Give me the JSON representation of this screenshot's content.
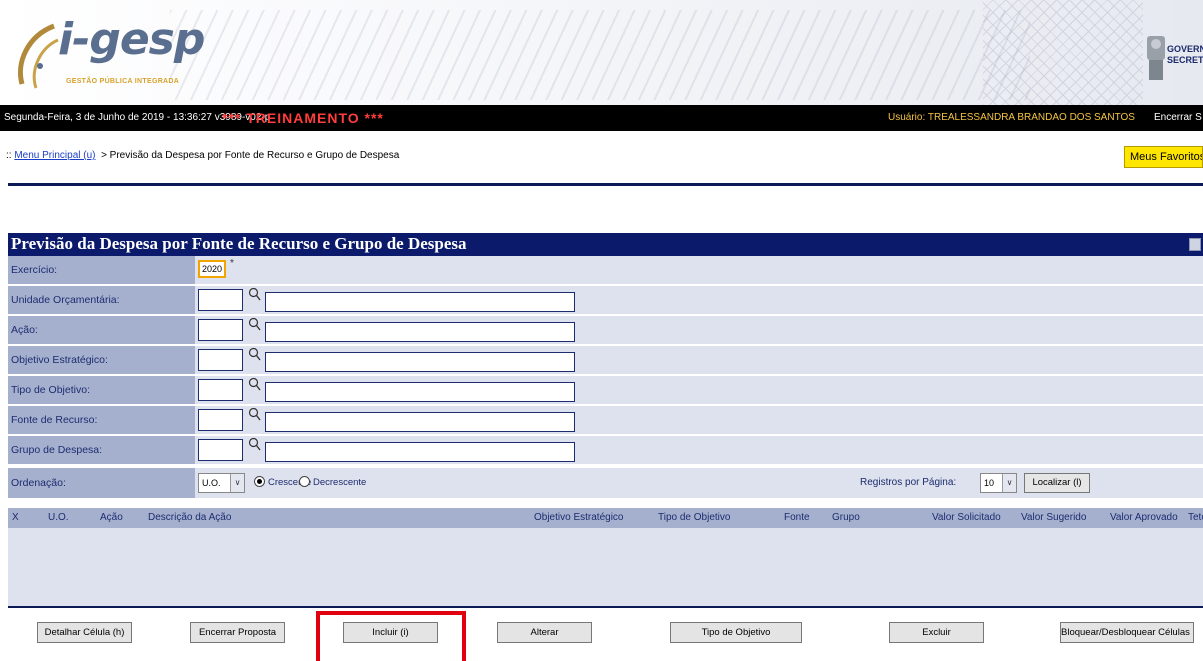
{
  "header": {
    "logo_text": "i-gesp",
    "logo_subtitle": "GESTÃO PÚBLICA INTEGRADA",
    "gov_line1": "GOVERNO",
    "gov_line2": "SECRETARIA"
  },
  "status": {
    "datetime_version": "Segunda-Feira, 3 de Junho de 2019 - 13:36:27   v3989-v02-p",
    "training": "*** TREINAMENTO ***",
    "user_label": "Usuário:",
    "user_name": "TREALESSANDRA BRANDAO DOS SANTOS",
    "logout": "Encerrar S"
  },
  "breadcrumb": {
    "prefix": "::",
    "menu_link": "Menu Principal (u)",
    "current": ">  Previsão da Despesa por Fonte de Recurso e Grupo de Despesa"
  },
  "favorites_label": "Meus Favoritos (x) ...",
  "form": {
    "title": "Previsão da Despesa por Fonte de Recurso e Grupo de Despesa",
    "exercicio_label": "Exercício:",
    "exercicio_value": "2020",
    "required_mark": "*",
    "fields": [
      {
        "label": "Unidade Orçamentária:"
      },
      {
        "label": "Ação:"
      },
      {
        "label": "Objetivo Estratégico:"
      },
      {
        "label": "Tipo de Objetivo:"
      },
      {
        "label": "Fonte de Recurso:"
      },
      {
        "label": "Grupo de Despesa:"
      }
    ],
    "ordenacao_label": "Ordenação:",
    "ordenacao_value": "U.O.",
    "crescente": "Crescente",
    "decrescente": "Decrescente",
    "registros_label": "Registros por Página:",
    "registros_value": "10",
    "localizar": "Localizar (l)"
  },
  "table": {
    "columns": [
      "X",
      "U.O.",
      "Ação",
      "Descrição da Ação",
      "Objetivo Estratégico",
      "Tipo de Objetivo",
      "Fonte",
      "Grupo",
      "Valor Solicitado",
      "Valor Sugerido",
      "Valor Aprovado",
      "Teto"
    ]
  },
  "buttons": {
    "detalhar": "Detalhar Célula (h)",
    "encerrar": "Encerrar Proposta",
    "incluir": "Incluir (i)",
    "alterar": "Alterar",
    "tipo_objetivo": "Tipo de Objetivo",
    "excluir": "Excluir",
    "bloquear": "Bloquear/Desbloquear Células (b)"
  },
  "colors": {
    "title_bar": "#0b1a6b",
    "label_bg": "#a5b0cf",
    "row_bg": "#dde2ee",
    "training": "#ff3d3d",
    "favorites": "#ffe600",
    "highlight": "#e0000f"
  }
}
